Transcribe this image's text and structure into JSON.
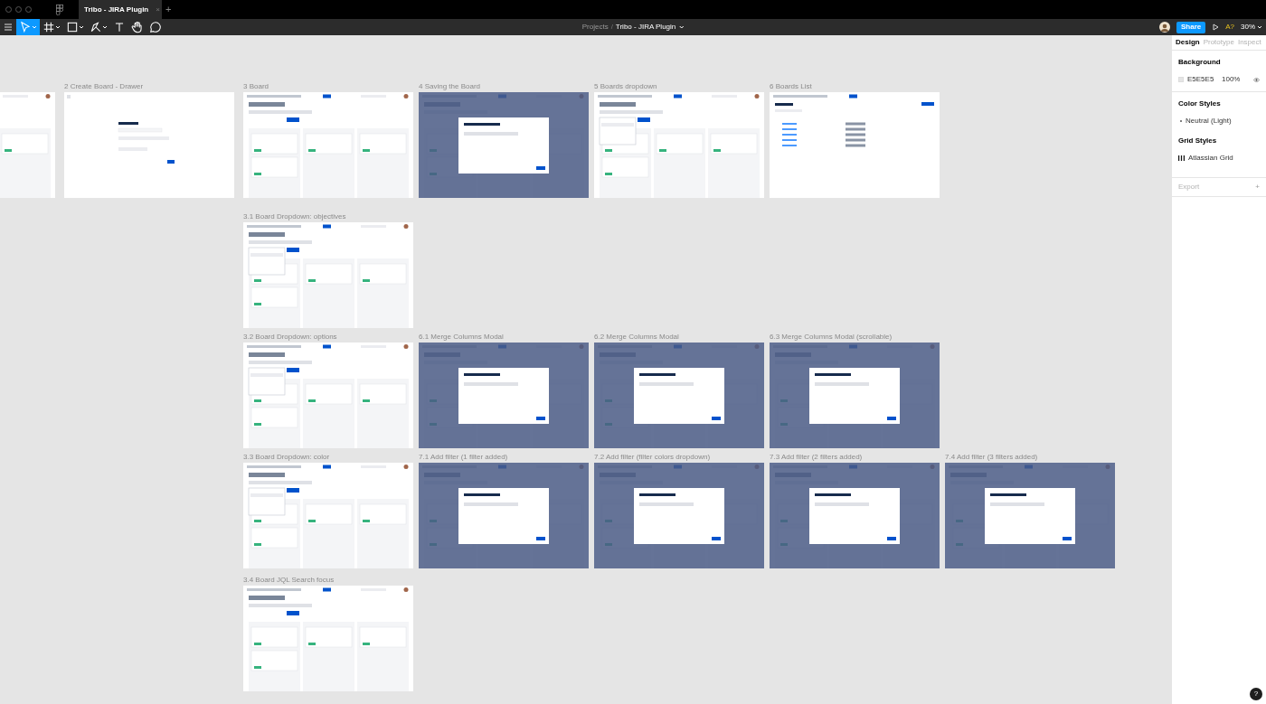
{
  "window": {
    "tab_title": "Tribo - JIRA Plugin",
    "tab_close": "×",
    "new_tab": "+"
  },
  "toolbar": {
    "tools": [
      {
        "kind": "move",
        "selected": true
      },
      {
        "kind": "frame",
        "selected": false
      },
      {
        "kind": "shape",
        "selected": false
      },
      {
        "kind": "pen",
        "selected": false
      },
      {
        "kind": "text",
        "selected": false
      },
      {
        "kind": "hand",
        "selected": false
      },
      {
        "kind": "comment",
        "selected": false
      }
    ],
    "breadcrumb": {
      "parent": "Projects",
      "separator": "/",
      "file": "Tribo - JIRA Plugin"
    },
    "share": "Share",
    "badge": "A?",
    "zoom": "30%"
  },
  "canvas": {
    "rows": [
      {
        "frames": [
          {
            "kind": "board"
          },
          {
            "title": "2 Create Board - Drawer",
            "kind": "drawer"
          },
          {
            "title": "3 Board",
            "kind": "board"
          },
          {
            "title": "4 Saving the Board",
            "kind": "modal"
          },
          {
            "title": "5 Boards dropdown",
            "kind": "menu"
          },
          {
            "title": "6 Boards List",
            "kind": "list"
          }
        ]
      },
      {
        "frames": [
          {
            "title": "3.1 Board Dropdown: objectives",
            "kind": "menu"
          }
        ]
      },
      {
        "frames": [
          {
            "title": "3.2 Board Dropdown: options",
            "kind": "menu"
          },
          {
            "title": "6.1 Merge Columns Modal",
            "kind": "modal"
          },
          {
            "title": "6.2 Merge Columns Modal",
            "kind": "modal"
          },
          {
            "title": "6.3 Merge Columns Modal (scrollable)",
            "kind": "modal"
          }
        ]
      },
      {
        "frames": [
          {
            "title": "3.3 Board Dropdown: color",
            "kind": "menu"
          },
          {
            "title": "7.1 Add filter (1 filter added)",
            "kind": "modal"
          },
          {
            "title": "7.2 Add filter (filter colors dropdown)",
            "kind": "modal"
          },
          {
            "title": "7.3 Add filter (2 filters added)",
            "kind": "modal"
          },
          {
            "title": "7.4 Add filter (3 filters added)",
            "kind": "modal"
          }
        ]
      },
      {
        "frames": [
          {
            "title": "3.4 Board JQL Search focus",
            "kind": "board"
          }
        ]
      }
    ]
  },
  "panel": {
    "tabs": [
      {
        "label": "Design",
        "selected": true
      },
      {
        "label": "Prototype",
        "selected": false
      },
      {
        "label": "Inspect",
        "selected": false
      }
    ],
    "background": {
      "heading": "Background",
      "hex": "E5E5E5",
      "opacity": "100%",
      "visible": true
    },
    "color_styles": {
      "heading": "Color Styles",
      "items": [
        "Neutral (Light)"
      ]
    },
    "grid_styles": {
      "heading": "Grid Styles",
      "items": [
        "Atlassian Grid"
      ]
    },
    "export": {
      "heading": "Export",
      "add": "+"
    }
  },
  "help": "?"
}
